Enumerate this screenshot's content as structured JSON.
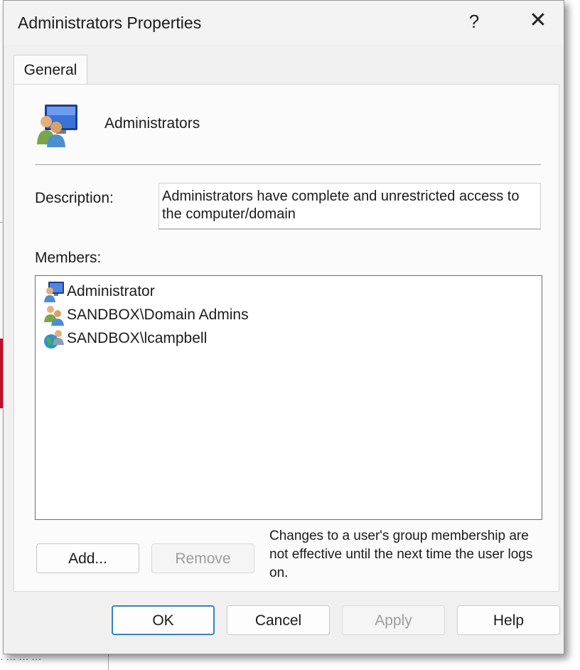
{
  "dialog": {
    "title": "Administrators Properties",
    "help_glyph": "?",
    "close_glyph": "✕"
  },
  "tabs": [
    {
      "label": "General",
      "selected": true
    }
  ],
  "general": {
    "group_icon": "user-group-monitor-icon",
    "group_name": "Administrators",
    "description_label": "Description:",
    "description_value": "Administrators have complete and unrestricted access to the computer/domain",
    "members_label": "Members:",
    "members": [
      {
        "name": "Administrator",
        "icon": "local-user-icon"
      },
      {
        "name": "SANDBOX\\Domain Admins",
        "icon": "group-icon"
      },
      {
        "name": "SANDBOX\\lcampbell",
        "icon": "domain-user-icon"
      }
    ],
    "add_label": "Add...",
    "remove_label": "Remove",
    "note": "Changes to a user's group membership are not effective until the next time the user logs on."
  },
  "buttons": {
    "ok": "OK",
    "cancel": "Cancel",
    "apply": "Apply",
    "help": "Help"
  },
  "colors": {
    "accent": "#3b7fc4",
    "dialog_bg": "#f0f0f0",
    "background_window_accent": "#c8102e"
  },
  "background": {
    "partial_text": "· ··· ··· ···"
  }
}
